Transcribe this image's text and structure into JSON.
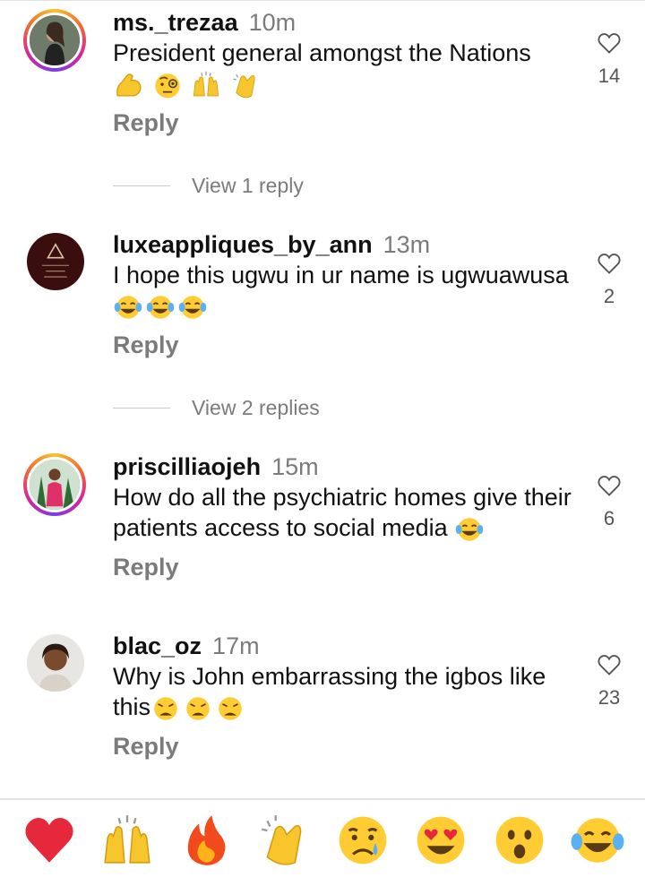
{
  "comments": [
    {
      "username": "ms._trezaa",
      "time": "10m",
      "text": "President general amongst the Nations",
      "emojis": [
        "flexed-biceps",
        "monocle-face",
        "raising-hands",
        "clapping-hands"
      ],
      "reply_label": "Reply",
      "likes": "14",
      "view_replies": "View 1 reply"
    },
    {
      "username": "luxeappliques_by_ann",
      "time": "13m",
      "text": "I hope this ugwu in ur name is ugwuawusa",
      "emojis": [
        "tears-of-joy",
        "tears-of-joy",
        "tears-of-joy"
      ],
      "reply_label": "Reply",
      "likes": "2",
      "view_replies": "View 2 replies"
    },
    {
      "username": "priscilliaojeh",
      "time": "15m",
      "text": "How do all the psychiatric homes give their patients access to social media",
      "emojis": [
        "tears-of-joy"
      ],
      "reply_label": "Reply",
      "likes": "6"
    },
    {
      "username": "blac_oz",
      "time": "17m",
      "text": "Why is John embarrassing the igbos like this",
      "emojis": [
        "weary-face",
        "weary-face",
        "weary-face"
      ],
      "reply_label": "Reply",
      "likes": "23"
    }
  ],
  "reaction_bar": [
    "red-heart",
    "raising-hands",
    "fire",
    "clapping-hands",
    "crying-face",
    "heart-eyes",
    "astonished-face",
    "tears-of-joy"
  ],
  "colors": {
    "text": "#111111",
    "muted": "#7b7b7b",
    "divider": "#e3e3e3",
    "heart_red": "#e5293a",
    "emoji_yellow": "#ffcc33"
  }
}
